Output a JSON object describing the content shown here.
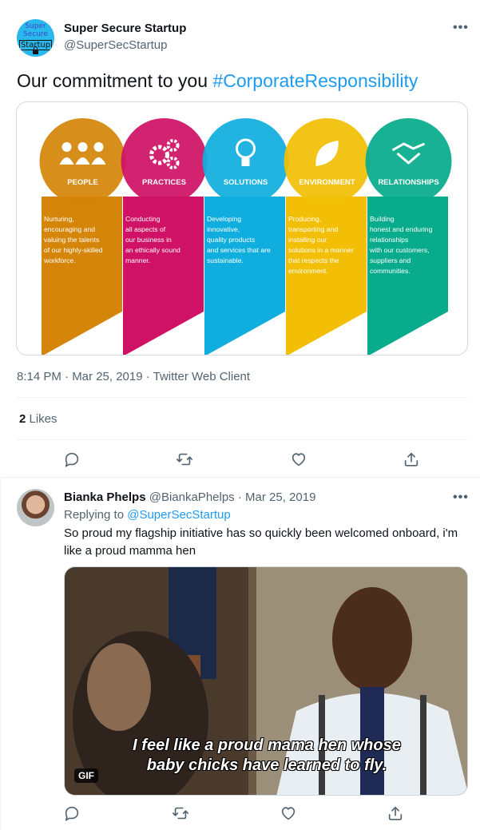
{
  "main_tweet": {
    "author_name": "Super Secure Startup",
    "author_handle": "@SuperSecStartup",
    "avatar_text": [
      "Super",
      "Secure",
      "Startup"
    ],
    "text": "Our commitment to you ",
    "hashtag": "#CorporateResponsibility",
    "more_label": "•••",
    "infographic": {
      "pillars": [
        {
          "title": "PEOPLE",
          "icon": "people-icon",
          "color": "#d4850a",
          "text": [
            "Nurturing,",
            "encouraging and",
            "valuing the talents",
            "of our highly-skilled",
            "workforce."
          ]
        },
        {
          "title": "PRACTICES",
          "icon": "gears-icon",
          "color": "#cf1265",
          "text": [
            "Conducting",
            "all aspects of",
            "our business in",
            "an ethically sound",
            "manner."
          ]
        },
        {
          "title": "SOLUTIONS",
          "icon": "lightbulb-icon",
          "color": "#10aede",
          "text": [
            "Developing",
            "innovative,",
            "quality products",
            "and services that are",
            "sustainable."
          ]
        },
        {
          "title": "ENVIRONMENT",
          "icon": "leaf-icon",
          "color": "#f2bf06",
          "text": [
            "Producing,",
            "transporting and",
            "installing our",
            "solutions in a manner",
            "that respects the",
            "environment."
          ]
        },
        {
          "title": "RELATIONSHIPS",
          "icon": "handshake-icon",
          "color": "#08ab8c",
          "text": [
            "Building",
            "honest and enduring",
            "relationships",
            "with our customers,",
            "suppliers and",
            "communities."
          ]
        }
      ]
    },
    "timestamp": "8:14 PM · Mar 25, 2019 · Twitter Web Client",
    "likes_count": "2",
    "likes_label": " Likes",
    "actions": [
      "reply-icon",
      "retweet-icon",
      "like-icon",
      "share-icon"
    ]
  },
  "reply_tweet": {
    "author_name": "Bianka Phelps",
    "author_handle": "@BiankaPhelps",
    "separator": " · ",
    "date": "Mar 25, 2019",
    "replying_prefix": "Replying to ",
    "replying_handle": "@SuperSecStartup",
    "text": "So proud my flagship initiative has so quickly been welcomed onboard, i'm like a proud mamma hen",
    "gif_caption_line1": "I feel like a proud mama hen whose",
    "gif_caption_line2": "baby chicks have learned to fly.",
    "gif_badge": "GIF",
    "more_label": "•••",
    "actions": [
      "reply-icon",
      "retweet-icon",
      "like-icon",
      "share-icon"
    ]
  }
}
